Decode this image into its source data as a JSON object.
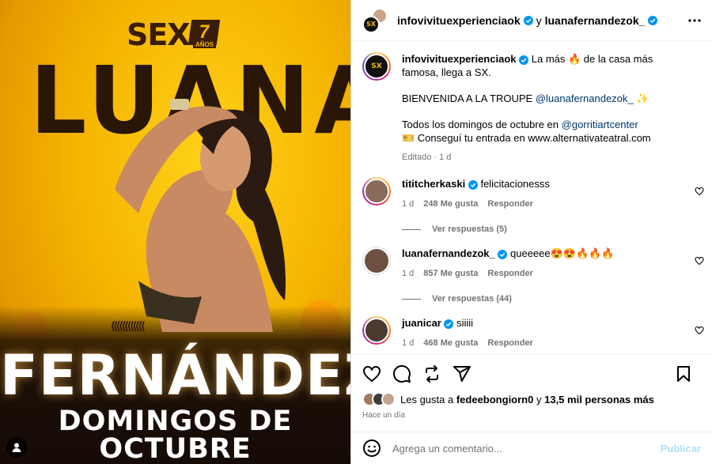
{
  "post_image": {
    "brand": "SEX",
    "brand_seven": "7",
    "brand_sub": "AÑOS",
    "first_name": "LUANA",
    "last_name": "FERNÁNDEZ",
    "event_line": "DOMINGOS DE OCTUBRE"
  },
  "header": {
    "author1": "infovivituexperienciaok",
    "joiner": "y",
    "author2": "luanafernandezok_"
  },
  "caption": {
    "username": "infovivituexperienciaok",
    "line1": "La más 🔥 de la casa más famosa, llega a SX.",
    "line2_text": "BIENVENIDA A LA TROUPE",
    "line2_mention": "@luanafernandezok_",
    "line2_emoji": "✨",
    "line3_text": "Todos los domingos de octubre en",
    "line3_mention": "@gorritiartcenter",
    "line4": "🎫 Conseguí tu entrada en www.alternativateatral.com",
    "meta": "Editado · 1 d"
  },
  "comments": [
    {
      "username": "tititcherkaski",
      "text": "felicitacionesss",
      "time": "1 d",
      "likes": "248 Me gusta",
      "reply": "Responder",
      "replies_label": "Ver respuestas (5)"
    },
    {
      "username": "luanafernandezok_",
      "text": "queeeee😍😍🔥🔥🔥",
      "time": "1 d",
      "likes": "857 Me gusta",
      "reply": "Responder",
      "replies_label": "Ver respuestas (44)"
    },
    {
      "username": "juanicar",
      "text": "siiiii",
      "time": "1 d",
      "likes": "468 Me gusta",
      "reply": "Responder"
    }
  ],
  "likes": {
    "prefix": "Les gusta a",
    "user": "fedeebongiorn0",
    "suffix": "y",
    "count": "13,5 mil personas más"
  },
  "time_ago": "Hace un día",
  "add_comment": {
    "placeholder": "Agrega un comentario...",
    "publish": "Publicar"
  },
  "colors": {
    "accent_yellow": "#f5b400",
    "verified_blue": "#0095f6",
    "link": "#00376b",
    "publish_disabled": "#b2dffc"
  }
}
